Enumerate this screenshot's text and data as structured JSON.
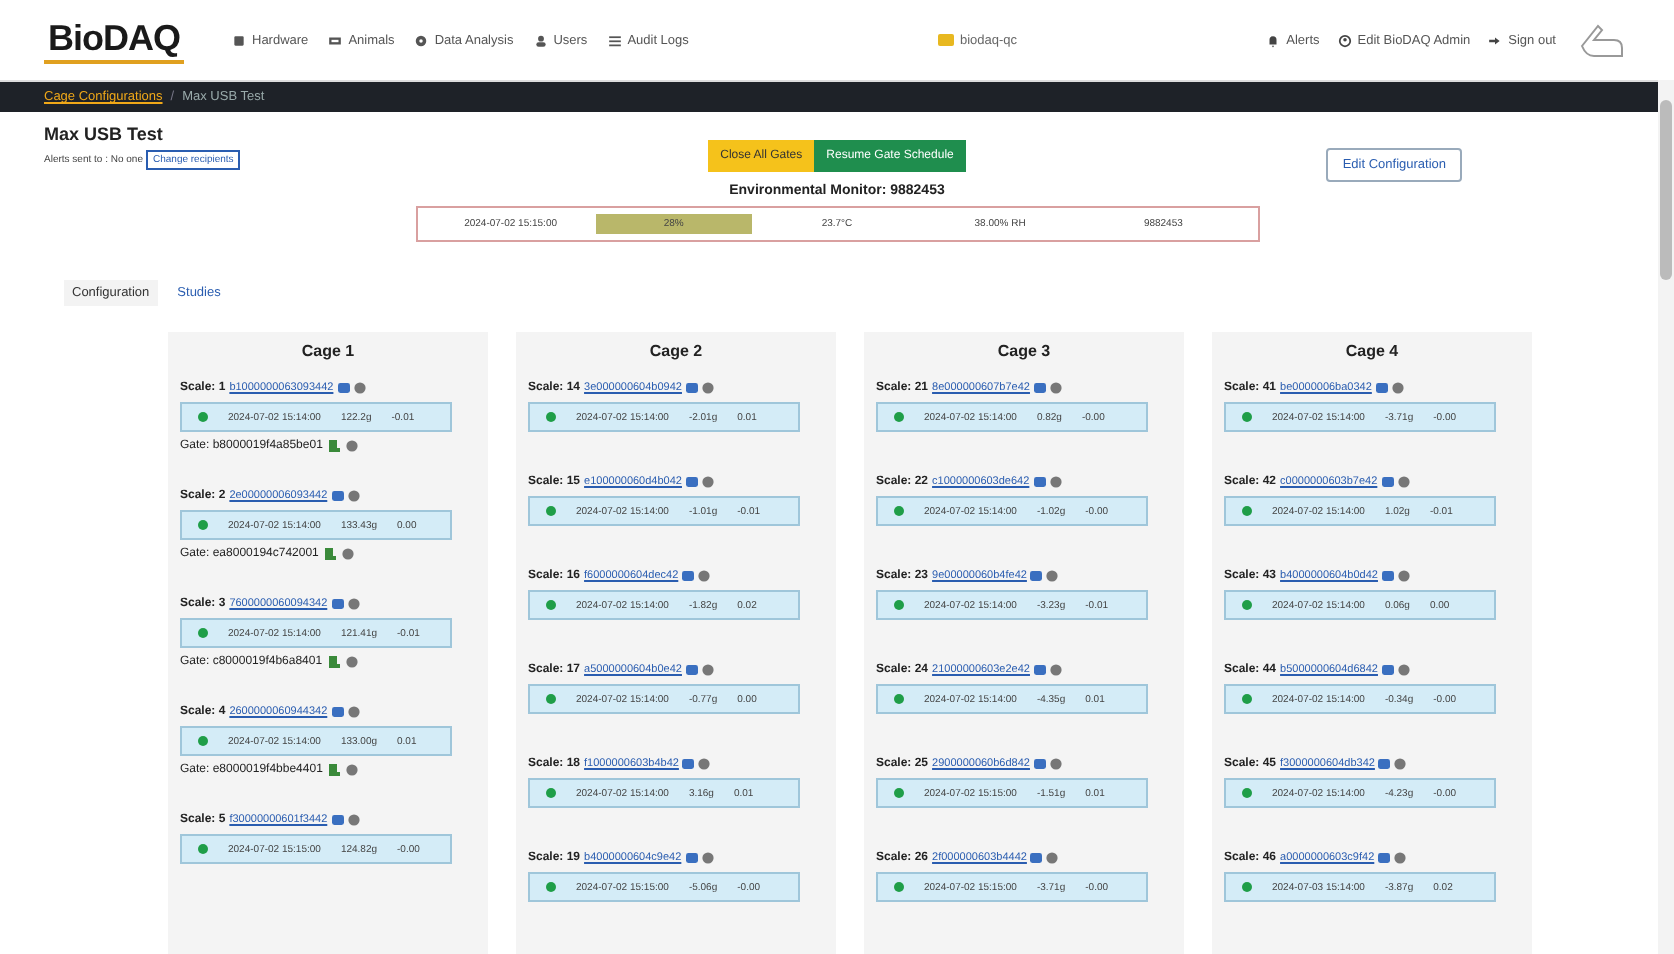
{
  "header": {
    "logo": "BioDAQ",
    "nav": [
      "Hardware",
      "Animals",
      "Data Analysis",
      "Users",
      "Audit Logs"
    ],
    "server": "biodaq-qc",
    "right": [
      "Alerts",
      "Edit BioDAQ Admin",
      "Sign out"
    ]
  },
  "breadcrumb": [
    {
      "label": "Cage Configurations",
      "kind": "link"
    },
    {
      "label": "/",
      "kind": "separator"
    },
    {
      "label": "Max USB Test",
      "kind": "current"
    }
  ],
  "config": {
    "title": "Max USB Test",
    "alerts_text": "Alerts sent to : No one",
    "change_button": "Change recipients"
  },
  "actions": [
    {
      "label": "Close All Gates",
      "kind": "warning"
    },
    {
      "label": "Resume Gate Schedule",
      "kind": "success"
    }
  ],
  "edit_button": "Edit Configuration",
  "monitor": {
    "title": "Environmental Monitor: 9882453",
    "cells": [
      {
        "text": "2024-07-02 15:15:00",
        "kind": "plain"
      },
      {
        "text": "28%",
        "kind": "highlight"
      },
      {
        "text": "23.7°C",
        "kind": "plain"
      },
      {
        "text": "38.00% RH",
        "kind": "plain"
      },
      {
        "text": "9882453",
        "kind": "plain"
      }
    ]
  },
  "tabs": [
    {
      "label": "Configuration",
      "selected": true
    },
    {
      "label": "Studies",
      "selected": false
    }
  ],
  "cages": [
    {
      "title": "Cage 1",
      "scales": [
        {
          "label": "Scale: 1",
          "id": "b1000000063093442",
          "time": "2024-07-02 15:14:00",
          "weight": "122.2g",
          "delta": "-0.01",
          "gate": "Gate: b8000019f4a85be01"
        },
        {
          "label": "Scale: 2",
          "id": "2e00000006093442",
          "time": "2024-07-02 15:14:00",
          "weight": "133.43g",
          "delta": "0.00",
          "gate": "Gate: ea8000194c742001"
        },
        {
          "label": "Scale: 3",
          "id": "7600000060094342",
          "time": "2024-07-02 15:14:00",
          "weight": "121.41g",
          "delta": "-0.01",
          "gate": "Gate: c8000019f4b6a8401"
        },
        {
          "label": "Scale: 4",
          "id": "2600000060944342",
          "time": "2024-07-02 15:14:00",
          "weight": "133.00g",
          "delta": "0.01",
          "gate": "Gate: e8000019f4bbe4401"
        },
        {
          "label": "Scale: 5",
          "id": "f30000000601f3442",
          "time": "2024-07-02 15:15:00",
          "weight": "124.82g",
          "delta": "-0.00"
        }
      ]
    },
    {
      "title": "Cage 2",
      "scales": [
        {
          "label": "Scale: 14",
          "id": "3e000000604b0942",
          "time": "2024-07-02 15:14:00",
          "weight": "-2.01g",
          "delta": "0.01"
        },
        {
          "label": "Scale: 15",
          "id": "e100000060d4b042",
          "time": "2024-07-02 15:14:00",
          "weight": "-1.01g",
          "delta": "-0.01"
        },
        {
          "label": "Scale: 16",
          "id": "f6000000604dec42",
          "time": "2024-07-02 15:14:00",
          "weight": "-1.82g",
          "delta": "0.02"
        },
        {
          "label": "Scale: 17",
          "id": "a5000000604b0e42",
          "time": "2024-07-02 15:14:00",
          "weight": "-0.77g",
          "delta": "0.00"
        },
        {
          "label": "Scale: 18",
          "id": "f1000000603b4b42",
          "time": "2024-07-02 15:14:00",
          "weight": "3.16g",
          "delta": "0.01"
        },
        {
          "label": "Scale: 19",
          "id": "b4000000604c9e42",
          "time": "2024-07-02 15:15:00",
          "weight": "-5.06g",
          "delta": "-0.00"
        }
      ]
    },
    {
      "title": "Cage 3",
      "scales": [
        {
          "label": "Scale: 21",
          "id": "8e000000607b7e42",
          "time": "2024-07-02 15:14:00",
          "weight": "0.82g",
          "delta": "-0.00"
        },
        {
          "label": "Scale: 22",
          "id": "c1000000603de642",
          "time": "2024-07-02 15:14:00",
          "weight": "-1.02g",
          "delta": "-0.00"
        },
        {
          "label": "Scale: 23",
          "id": "9e00000060b4fe42",
          "time": "2024-07-02 15:14:00",
          "weight": "-3.23g",
          "delta": "-0.01"
        },
        {
          "label": "Scale: 24",
          "id": "21000000603e2e42",
          "time": "2024-07-02 15:14:00",
          "weight": "-4.35g",
          "delta": "0.01"
        },
        {
          "label": "Scale: 25",
          "id": "2900000060b6d842",
          "time": "2024-07-02 15:15:00",
          "weight": "-1.51g",
          "delta": "0.01"
        },
        {
          "label": "Scale: 26",
          "id": "2f000000603b4442",
          "time": "2024-07-02 15:15:00",
          "weight": "-3.71g",
          "delta": "-0.00"
        }
      ]
    },
    {
      "title": "Cage 4",
      "scales": [
        {
          "label": "Scale: 41",
          "id": "be0000006ba0342",
          "time": "2024-07-02 15:14:00",
          "weight": "-3.71g",
          "delta": "-0.00"
        },
        {
          "label": "Scale: 42",
          "id": "c0000000603b7e42",
          "time": "2024-07-02 15:14:00",
          "weight": "1.02g",
          "delta": "-0.01"
        },
        {
          "label": "Scale: 43",
          "id": "b4000000604b0d42",
          "time": "2024-07-02 15:14:00",
          "weight": "0.06g",
          "delta": "0.00"
        },
        {
          "label": "Scale: 44",
          "id": "b5000000604d6842",
          "time": "2024-07-02 15:14:00",
          "weight": "-0.34g",
          "delta": "-0.00"
        },
        {
          "label": "Scale: 45",
          "id": "f3000000604db342",
          "time": "2024-07-02 15:14:00",
          "weight": "-4.23g",
          "delta": "-0.00"
        },
        {
          "label": "Scale: 46",
          "id": "a0000000603c9f42",
          "time": "2024-07-03 15:14:00",
          "weight": "-3.87g",
          "delta": "0.02"
        }
      ]
    }
  ]
}
